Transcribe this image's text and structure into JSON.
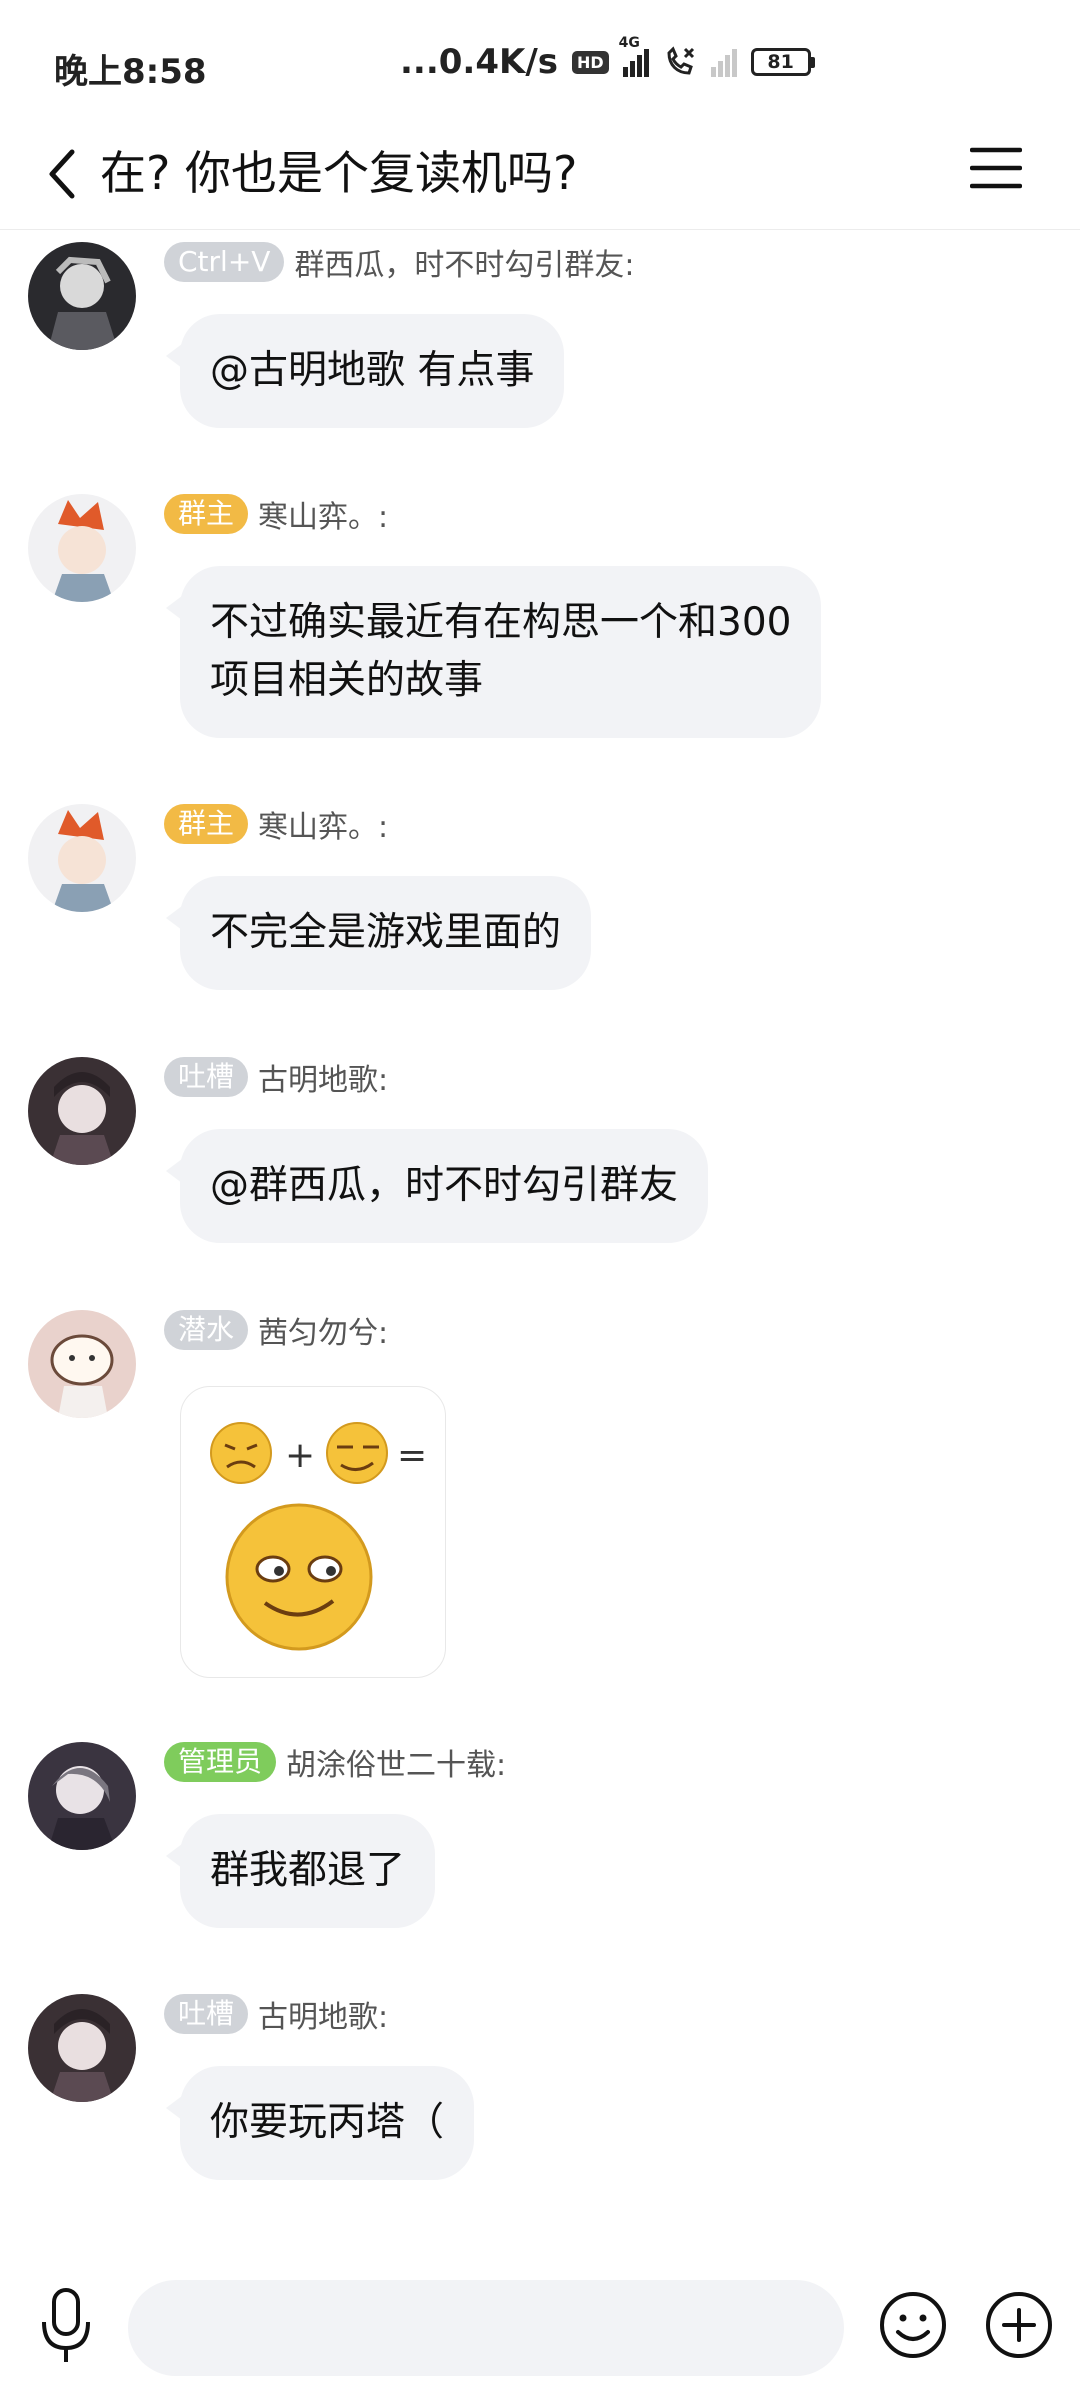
{
  "status_bar": {
    "time": "晚上8:58",
    "net_speed": "...0.4K/s",
    "hd": "HD",
    "network": "4G",
    "battery": "81"
  },
  "header": {
    "title": "在? 你也是个复读机吗?",
    "back_icon": "chevron-left-icon",
    "menu_icon": "hamburger-menu-icon"
  },
  "messages": [
    {
      "badge": "Ctrl+V",
      "badge_color": "#d0d3d8",
      "sender": "群西瓜，时不时勾引群友:",
      "text": "@古明地歌 有点事"
    },
    {
      "badge": "群主",
      "badge_color": "#f2ba45",
      "sender": "寒山弈。:",
      "text": "不过确实最近有在构思一个和300\n项目相关的故事"
    },
    {
      "badge": "群主",
      "badge_color": "#f2ba45",
      "sender": "寒山弈。:",
      "text": "不完全是游戏里面的"
    },
    {
      "badge": "吐槽",
      "badge_color": "#d0d3d8",
      "sender": "古明地歌:",
      "text": "@群西瓜，时不时勾引群友"
    },
    {
      "badge": "潜水",
      "badge_color": "#d0d3d8",
      "sender": "茜匀勿兮:",
      "image": "emoji-sticker: sad-face + smug-face = grin-face"
    },
    {
      "badge": "管理员",
      "badge_color": "#7fcc5c",
      "sender": "胡涂俗世二十载:",
      "text": "群我都退了"
    },
    {
      "badge": "吐槽",
      "badge_color": "#d0d3d8",
      "sender": "古明地歌:",
      "text": "你要玩丙塔（"
    }
  ],
  "input_bar": {
    "placeholder": "",
    "voice_icon": "microphone-icon",
    "emoji_icon": "smiley-icon",
    "plus_icon": "plus-circle-icon"
  }
}
